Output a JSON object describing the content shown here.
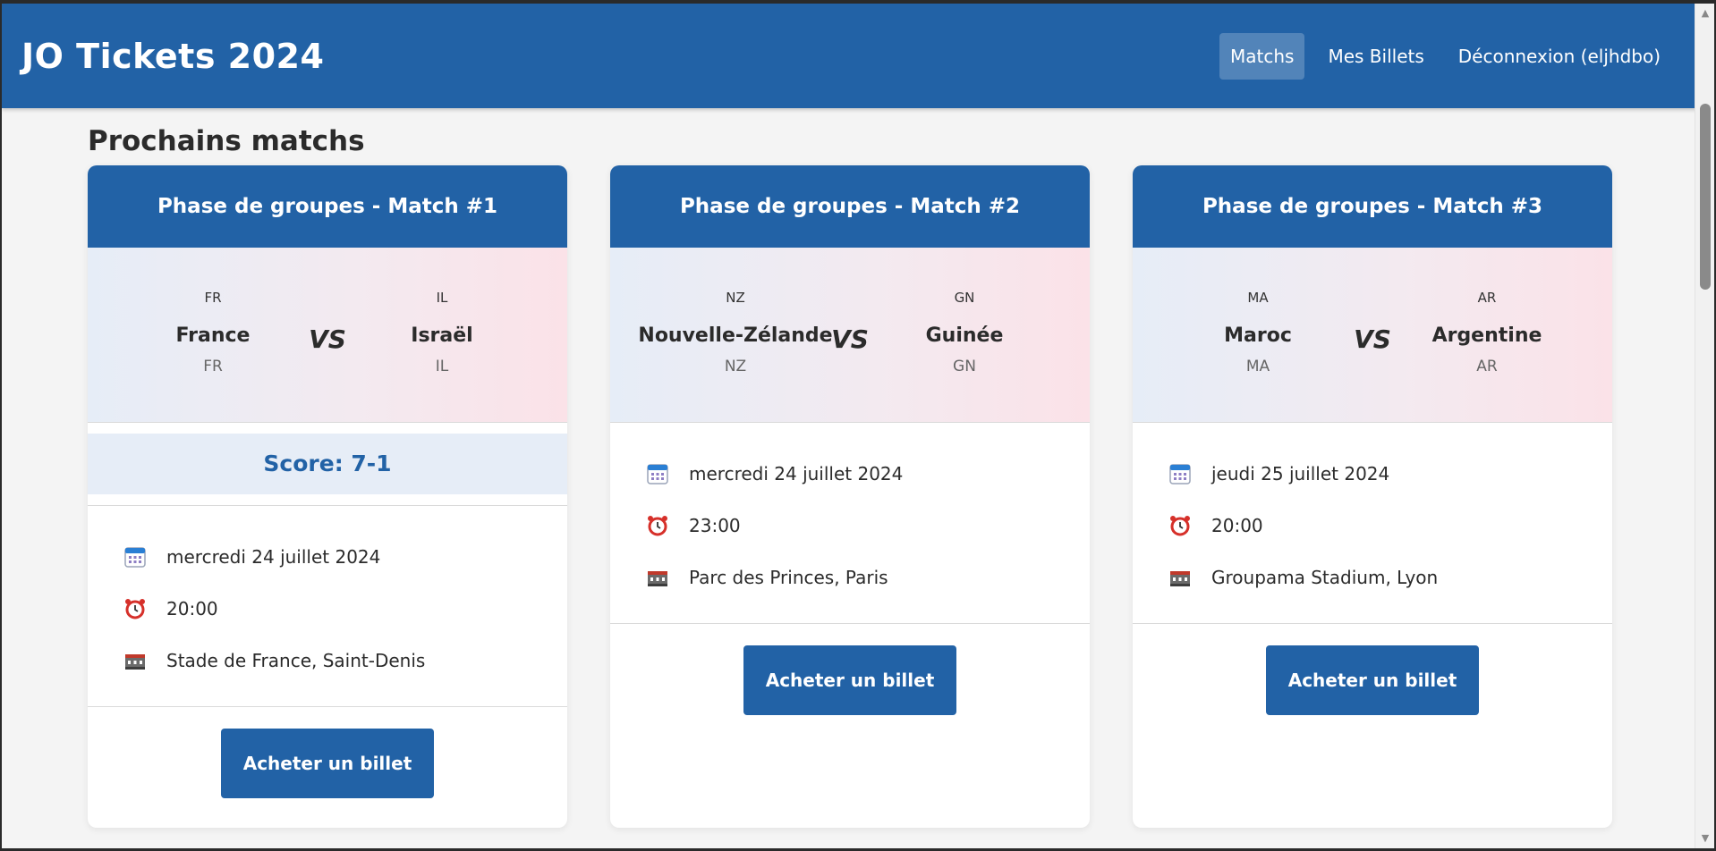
{
  "app": {
    "brand": "JO Tickets 2024",
    "nav": [
      {
        "label": "Matchs",
        "active": true
      },
      {
        "label": "Mes Billets",
        "active": false
      },
      {
        "label": "Déconnexion (eljhdbo)",
        "active": false
      }
    ]
  },
  "main": {
    "section_title": "Prochains matchs",
    "buy_label": "Acheter un billet",
    "vs_label": "VS",
    "cards": [
      {
        "title": "Phase de groupes - Match #1",
        "team1": {
          "code": "FR",
          "name": "France",
          "code2": "FR"
        },
        "team2": {
          "code": "IL",
          "name": "Israël",
          "code2": "IL"
        },
        "score": "Score: 7-1",
        "date": "mercredi 24 juillet 2024",
        "time": "20:00",
        "venue": "Stade de France, Saint-Denis"
      },
      {
        "title": "Phase de groupes - Match #2",
        "team1": {
          "code": "NZ",
          "name": "Nouvelle-Zélande",
          "code2": "NZ"
        },
        "team2": {
          "code": "GN",
          "name": "Guinée",
          "code2": "GN"
        },
        "date": "mercredi 24 juillet 2024",
        "time": "23:00",
        "venue": "Parc des Princes, Paris"
      },
      {
        "title": "Phase de groupes - Match #3",
        "team1": {
          "code": "MA",
          "name": "Maroc",
          "code2": "MA"
        },
        "team2": {
          "code": "AR",
          "name": "Argentine",
          "code2": "AR"
        },
        "date": "jeudi 25 juillet 2024",
        "time": "20:00",
        "venue": "Groupama Stadium, Lyon"
      }
    ]
  },
  "icons": {
    "calendar": "calendar-icon",
    "clock": "alarm-clock-icon",
    "stadium": "stadium-icon"
  },
  "colors": {
    "primary": "#2262a6",
    "score_bg": "#e6edf7",
    "background": "#f4f4f4"
  }
}
